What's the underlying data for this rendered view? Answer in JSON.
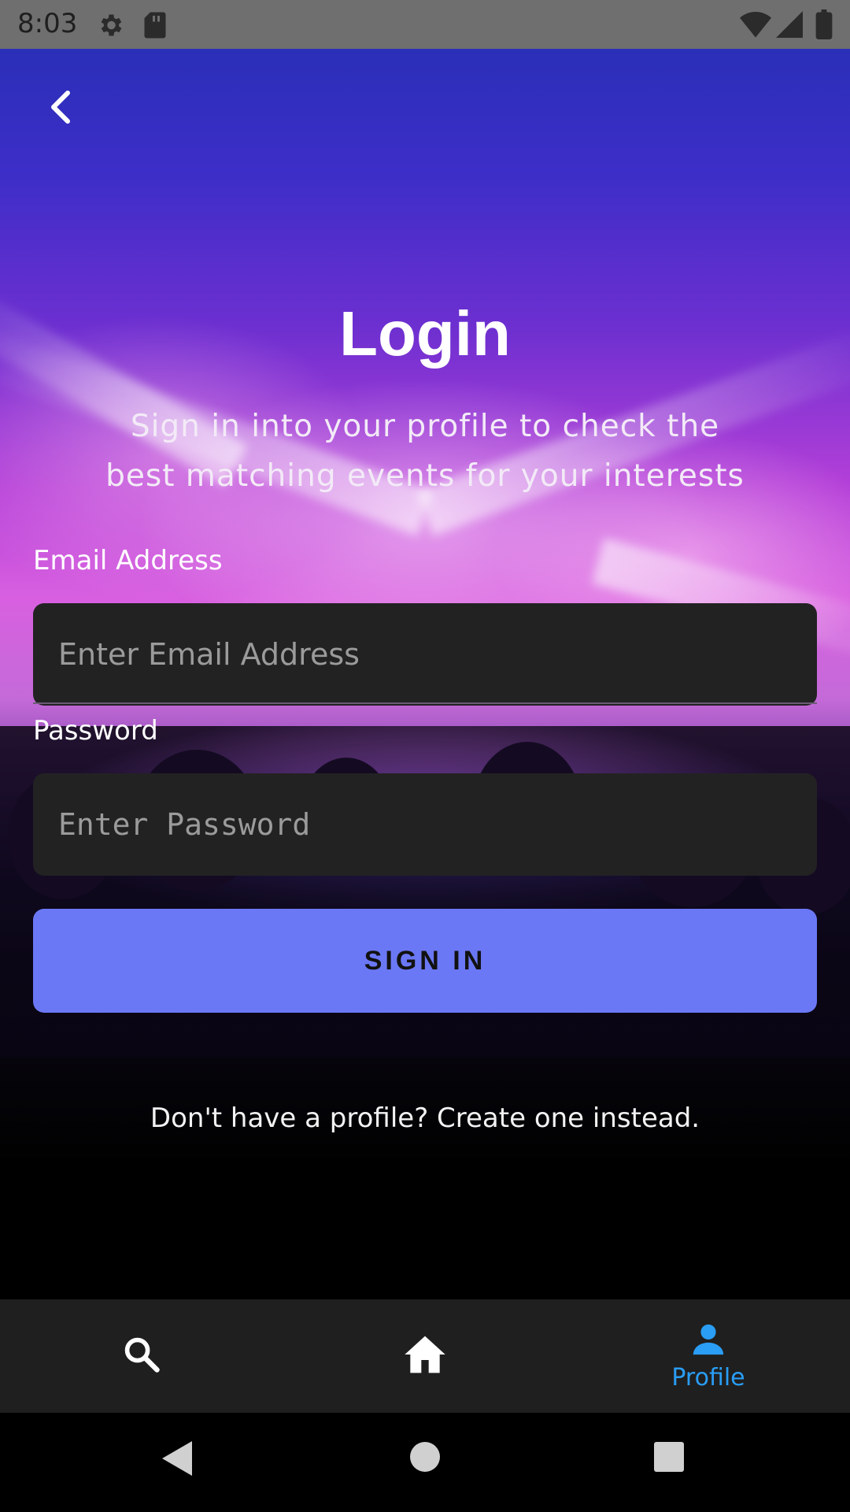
{
  "status_bar": {
    "time": "8:03",
    "icons": [
      "gear-icon",
      "sd-card-icon",
      "wifi-icon",
      "signal-icon",
      "battery-icon"
    ]
  },
  "header": {
    "back_icon": "chevron-left-icon"
  },
  "login": {
    "title": "Login",
    "subtitle": "Sign in into your profile to check the best matching events for your interests",
    "email_label": "Email Address",
    "email_placeholder": "Enter Email Address",
    "email_value": "",
    "password_label": "Password",
    "password_placeholder": "Enter Password",
    "password_value": "",
    "sign_in_label": "SIGN IN",
    "create_profile_text": "Don't have a profile? Create one instead."
  },
  "bottom_nav": {
    "items": [
      {
        "icon": "search-icon",
        "label": ""
      },
      {
        "icon": "home-icon",
        "label": ""
      },
      {
        "icon": "person-icon",
        "label": "Profile",
        "active": true
      }
    ],
    "active_color": "#2a9df4"
  },
  "system_nav": {
    "buttons": [
      "back-triangle-icon",
      "home-circle-icon",
      "recents-square-icon"
    ]
  },
  "colors": {
    "accent_button": "#6b78f5",
    "input_background": "#232223",
    "nav_background": "#1f1f1f"
  }
}
